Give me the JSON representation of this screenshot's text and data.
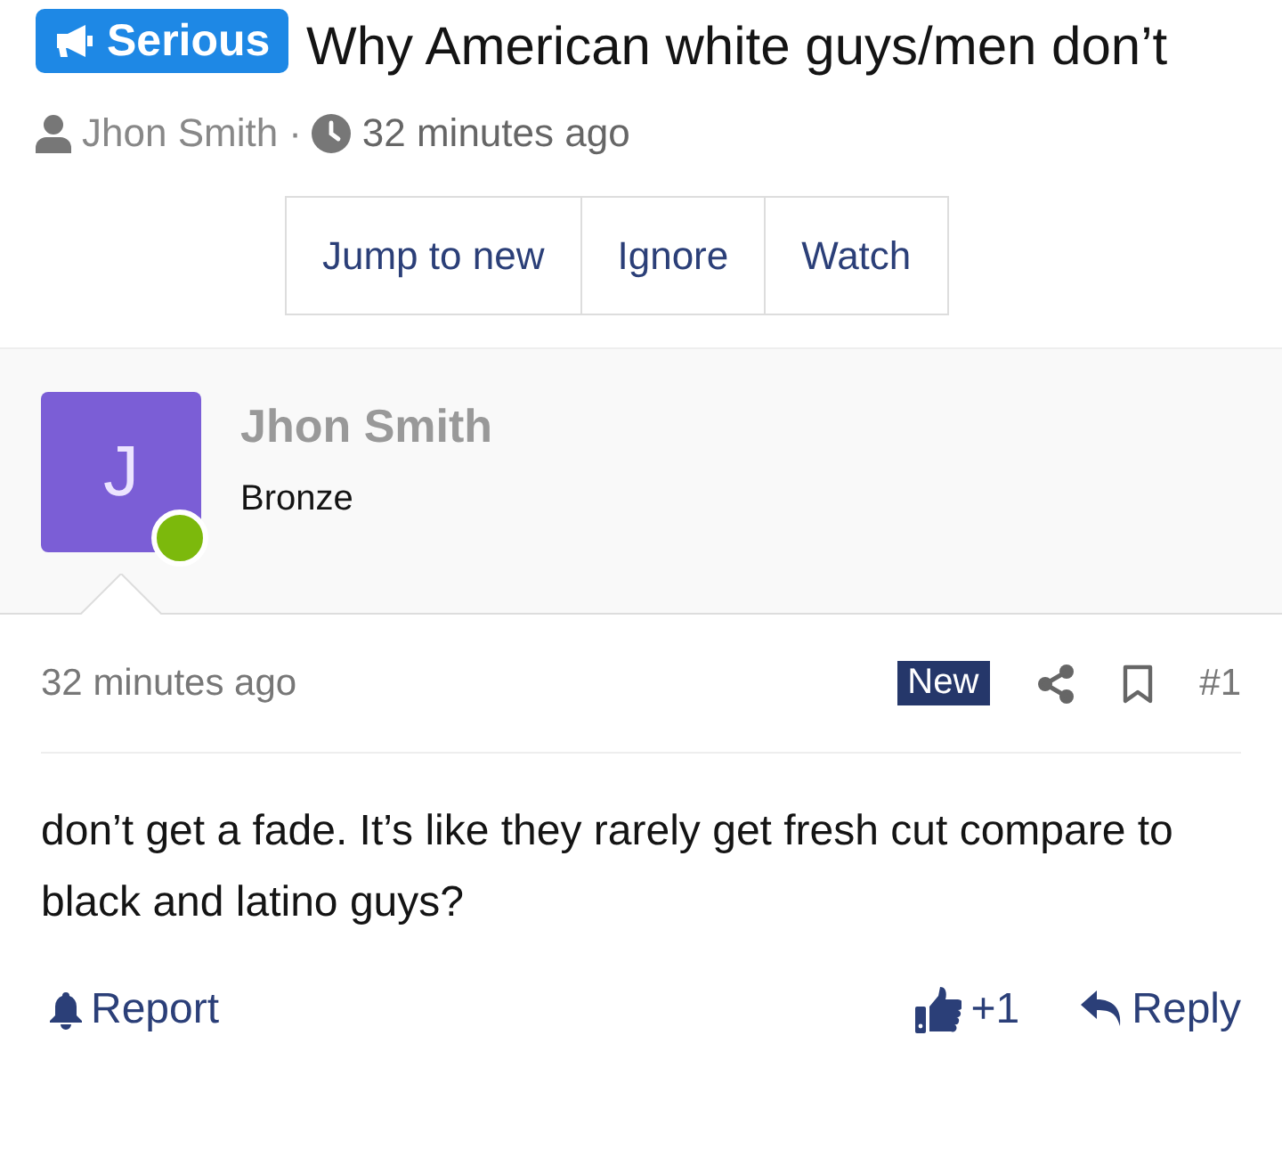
{
  "thread": {
    "prefix": "Serious",
    "title": "Why American white guys/men don’t",
    "author": "Jhon Smith",
    "separator": "·",
    "time": "32 minutes ago"
  },
  "actions": [
    {
      "label": "Jump to new"
    },
    {
      "label": "Ignore"
    },
    {
      "label": "Watch"
    }
  ],
  "post": {
    "avatar_letter": "J",
    "online": true,
    "author": "Jhon Smith",
    "rank": "Bronze",
    "time": "32 minutes ago",
    "new_badge": "New",
    "number": "#1",
    "body": "don’t get a fade. It’s like they rarely get fresh cut compare to black and latino guys?",
    "report": "Report",
    "likes": "+1",
    "reply": "Reply"
  }
}
